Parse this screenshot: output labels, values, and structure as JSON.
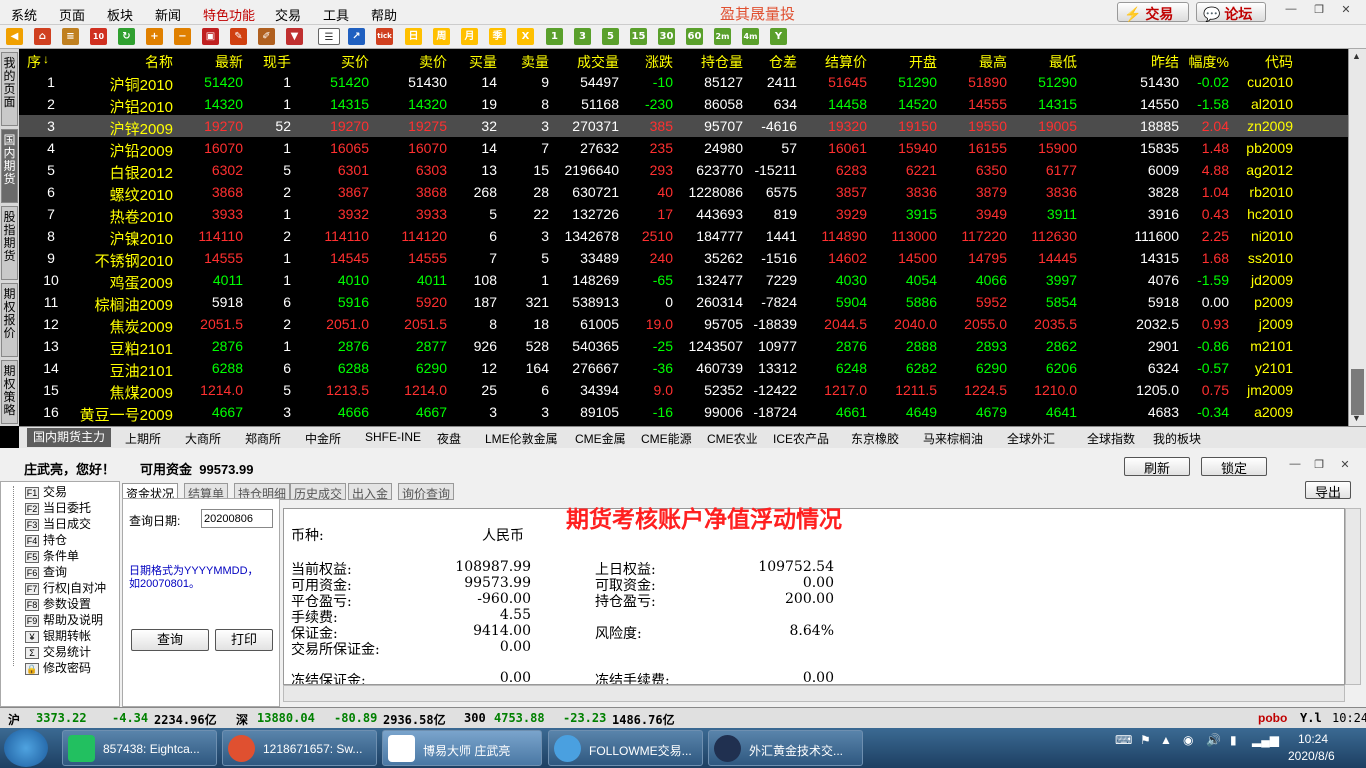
{
  "menu": {
    "items": [
      "系统",
      "页面",
      "板块",
      "新闻",
      "特色功能",
      "交易",
      "工具",
      "帮助"
    ],
    "app_title": "盈其晟量投",
    "trade_btn": "交易",
    "forum_btn": "论坛"
  },
  "toolbar": {
    "period_labels": [
      "日",
      "周",
      "月",
      "季",
      "X"
    ],
    "minute_labels": [
      "1",
      "3",
      "5",
      "15",
      "30",
      "60",
      "2m",
      "4m",
      "Y"
    ]
  },
  "sidetabs": [
    "我的页面",
    "国内期货",
    "股指期货",
    "期权报价",
    "期权策略"
  ],
  "quote_header": [
    "序",
    "名称",
    "最新",
    "现手",
    "买价",
    "卖价",
    "买量",
    "卖量",
    "成交量",
    "涨跌",
    "持仓量",
    "仓差",
    "结算价",
    "开盘",
    "最高",
    "最低",
    "昨结",
    "幅度%",
    "代码"
  ],
  "rows": [
    {
      "no": "1",
      "name": "沪铜2010",
      "last": "51420",
      "lot": "1",
      "bid": "51420",
      "ask": "51430",
      "bidv": "14",
      "askv": "9",
      "vol": "54497",
      "chg": "-10",
      "oi": "85127",
      "oichg": "2411",
      "settle": "51645",
      "open": "51290",
      "high": "51890",
      "low": "51290",
      "pre": "51430",
      "pct": "-0.02",
      "code": "cu2010",
      "dir": "down"
    },
    {
      "no": "2",
      "name": "沪铝2010",
      "last": "14320",
      "lot": "1",
      "bid": "14315",
      "ask": "14320",
      "bidv": "19",
      "askv": "8",
      "vol": "51168",
      "chg": "-230",
      "oi": "86058",
      "oichg": "634",
      "settle": "14458",
      "open": "14520",
      "high": "14555",
      "low": "14315",
      "pre": "14550",
      "pct": "-1.58",
      "code": "al2010",
      "dir": "down"
    },
    {
      "no": "3",
      "name": "沪锌2009",
      "last": "19270",
      "lot": "52",
      "bid": "19270",
      "ask": "19275",
      "bidv": "32",
      "askv": "3",
      "vol": "270371",
      "chg": "385",
      "oi": "95707",
      "oichg": "-4616",
      "settle": "19320",
      "open": "19150",
      "high": "19550",
      "low": "19005",
      "pre": "18885",
      "pct": "2.04",
      "code": "zn2009",
      "dir": "up"
    },
    {
      "no": "4",
      "name": "沪铅2009",
      "last": "16070",
      "lot": "1",
      "bid": "16065",
      "ask": "16070",
      "bidv": "14",
      "askv": "7",
      "vol": "27632",
      "chg": "235",
      "oi": "24980",
      "oichg": "57",
      "settle": "16061",
      "open": "15940",
      "high": "16155",
      "low": "15900",
      "pre": "15835",
      "pct": "1.48",
      "code": "pb2009",
      "dir": "up"
    },
    {
      "no": "5",
      "name": "白银2012",
      "last": "6302",
      "lot": "5",
      "bid": "6301",
      "ask": "6303",
      "bidv": "13",
      "askv": "15",
      "vol": "2196640",
      "chg": "293",
      "oi": "623770",
      "oichg": "-15211",
      "settle": "6283",
      "open": "6221",
      "high": "6350",
      "low": "6177",
      "pre": "6009",
      "pct": "4.88",
      "code": "ag2012",
      "dir": "up"
    },
    {
      "no": "6",
      "name": "螺纹2010",
      "last": "3868",
      "lot": "2",
      "bid": "3867",
      "ask": "3868",
      "bidv": "268",
      "askv": "28",
      "vol": "630721",
      "chg": "40",
      "oi": "1228086",
      "oichg": "6575",
      "settle": "3857",
      "open": "3836",
      "high": "3879",
      "low": "3836",
      "pre": "3828",
      "pct": "1.04",
      "code": "rb2010",
      "dir": "up"
    },
    {
      "no": "7",
      "name": "热卷2010",
      "last": "3933",
      "lot": "1",
      "bid": "3932",
      "ask": "3933",
      "bidv": "5",
      "askv": "22",
      "vol": "132726",
      "chg": "17",
      "oi": "443693",
      "oichg": "819",
      "settle": "3929",
      "open": "3915",
      "high": "3949",
      "low": "3911",
      "pre": "3916",
      "pct": "0.43",
      "code": "hc2010",
      "dir": "up"
    },
    {
      "no": "8",
      "name": "沪镍2010",
      "last": "114110",
      "lot": "2",
      "bid": "114110",
      "ask": "114120",
      "bidv": "6",
      "askv": "3",
      "vol": "1342678",
      "chg": "2510",
      "oi": "184777",
      "oichg": "1441",
      "settle": "114890",
      "open": "113000",
      "high": "117220",
      "low": "112630",
      "pre": "111600",
      "pct": "2.25",
      "code": "ni2010",
      "dir": "up"
    },
    {
      "no": "9",
      "name": "不锈钢2010",
      "last": "14555",
      "lot": "1",
      "bid": "14545",
      "ask": "14555",
      "bidv": "7",
      "askv": "5",
      "vol": "33489",
      "chg": "240",
      "oi": "35262",
      "oichg": "-1516",
      "settle": "14602",
      "open": "14500",
      "high": "14795",
      "low": "14445",
      "pre": "14315",
      "pct": "1.68",
      "code": "ss2010",
      "dir": "up"
    },
    {
      "no": "10",
      "name": "鸡蛋2009",
      "last": "4011",
      "lot": "1",
      "bid": "4010",
      "ask": "4011",
      "bidv": "108",
      "askv": "1",
      "vol": "148269",
      "chg": "-65",
      "oi": "132477",
      "oichg": "7229",
      "settle": "4030",
      "open": "4054",
      "high": "4066",
      "low": "3997",
      "pre": "4076",
      "pct": "-1.59",
      "code": "jd2009",
      "dir": "down"
    },
    {
      "no": "11",
      "name": "棕榈油2009",
      "last": "5918",
      "lot": "6",
      "bid": "5916",
      "ask": "5920",
      "bidv": "187",
      "askv": "321",
      "vol": "538913",
      "chg": "0",
      "oi": "260314",
      "oichg": "-7824",
      "settle": "5904",
      "open": "5886",
      "high": "5952",
      "low": "5854",
      "pre": "5918",
      "pct": "0.00",
      "code": "p2009",
      "dir": "flat"
    },
    {
      "no": "12",
      "name": "焦炭2009",
      "last": "2051.5",
      "lot": "2",
      "bid": "2051.0",
      "ask": "2051.5",
      "bidv": "8",
      "askv": "18",
      "vol": "61005",
      "chg": "19.0",
      "oi": "95705",
      "oichg": "-18839",
      "settle": "2044.5",
      "open": "2040.0",
      "high": "2055.0",
      "low": "2035.5",
      "pre": "2032.5",
      "pct": "0.93",
      "code": "j2009",
      "dir": "up"
    },
    {
      "no": "13",
      "name": "豆粕2101",
      "last": "2876",
      "lot": "1",
      "bid": "2876",
      "ask": "2877",
      "bidv": "926",
      "askv": "528",
      "vol": "540365",
      "chg": "-25",
      "oi": "1243507",
      "oichg": "10977",
      "settle": "2876",
      "open": "2888",
      "high": "2893",
      "low": "2862",
      "pre": "2901",
      "pct": "-0.86",
      "code": "m2101",
      "dir": "down"
    },
    {
      "no": "14",
      "name": "豆油2101",
      "last": "6288",
      "lot": "6",
      "bid": "6288",
      "ask": "6290",
      "bidv": "12",
      "askv": "164",
      "vol": "276667",
      "chg": "-36",
      "oi": "460739",
      "oichg": "13312",
      "settle": "6248",
      "open": "6282",
      "high": "6290",
      "low": "6206",
      "pre": "6324",
      "pct": "-0.57",
      "code": "y2101",
      "dir": "down"
    },
    {
      "no": "15",
      "name": "焦煤2009",
      "last": "1214.0",
      "lot": "5",
      "bid": "1213.5",
      "ask": "1214.0",
      "bidv": "25",
      "askv": "6",
      "vol": "34394",
      "chg": "9.0",
      "oi": "52352",
      "oichg": "-12422",
      "settle": "1217.0",
      "open": "1211.5",
      "high": "1224.5",
      "low": "1210.0",
      "pre": "1205.0",
      "pct": "0.75",
      "code": "jm2009",
      "dir": "up"
    },
    {
      "no": "16",
      "name": "黄豆一号2009",
      "last": "4667",
      "lot": "3",
      "bid": "4666",
      "ask": "4667",
      "bidv": "3",
      "askv": "3",
      "vol": "89105",
      "chg": "-16",
      "oi": "99006",
      "oichg": "-18724",
      "settle": "4661",
      "open": "4649",
      "high": "4679",
      "low": "4641",
      "pre": "4683",
      "pct": "-0.34",
      "code": "a2009",
      "dir": "down"
    }
  ],
  "bottom_tabs": [
    "国内期货主力",
    "上期所",
    "大商所",
    "郑商所",
    "中金所",
    "SHFE-INE",
    "夜盘",
    "LME伦敦金属",
    "CME金属",
    "CME能源",
    "CME农业",
    "ICE农产品",
    "东京橡胶",
    "马来棕榈油",
    "全球外汇",
    "全球指数",
    "我的板块"
  ],
  "trade": {
    "greeting": "庄武亮，您好！",
    "avail_label": "可用资金",
    "avail_value": "99573.99",
    "refresh": "刷新",
    "lock": "锁定",
    "export": "导出",
    "functions": [
      {
        "key": "F1",
        "label": "交易"
      },
      {
        "key": "F2",
        "label": "当日委托"
      },
      {
        "key": "F3",
        "label": "当日成交"
      },
      {
        "key": "F4",
        "label": "持仓"
      },
      {
        "key": "F5",
        "label": "条件单"
      },
      {
        "key": "F6",
        "label": "查询"
      },
      {
        "key": "F7",
        "label": "行权|自对冲"
      },
      {
        "key": "F8",
        "label": "参数设置"
      },
      {
        "key": "F9",
        "label": "帮助及说明"
      },
      {
        "key": "¥",
        "label": "银期转帐"
      },
      {
        "key": "Σ",
        "label": "交易统计"
      },
      {
        "key": "🔒",
        "label": "修改密码"
      }
    ],
    "subtabs": [
      "资金状况",
      "结算单",
      "持仓明细",
      "历史成交",
      "出入金",
      "询价查询"
    ],
    "query_date_label": "查询日期:",
    "query_date_value": "20200806",
    "date_hint": "日期格式为YYYYMMDD，如20070801。",
    "query_btn": "查询",
    "print_btn": "打印",
    "overlay_title": "期货考核账户净值浮动情况",
    "report": {
      "currency_label": "币种:",
      "currency_value": "人民币",
      "left": [
        {
          "label": "当前权益:",
          "value": "108987.99"
        },
        {
          "label": "可用资金:",
          "value": "99573.99"
        },
        {
          "label": "平仓盈亏:",
          "value": "-960.00"
        },
        {
          "label": "手续费:",
          "value": "4.55"
        },
        {
          "label": "保证金:",
          "value": "9414.00"
        },
        {
          "label": "交易所保证金:",
          "value": "0.00"
        }
      ],
      "right": [
        {
          "label": "上日权益:",
          "value": "109752.54"
        },
        {
          "label": "可取资金:",
          "value": "0.00"
        },
        {
          "label": "持仓盈亏:",
          "value": "200.00"
        },
        {
          "label": "风险度:",
          "value": "8.64%"
        }
      ],
      "frozen_margin_label": "冻结保证金:",
      "frozen_margin_value": "0.00",
      "frozen_fee_label": "冻结手续费:",
      "frozen_fee_value": "0.00"
    }
  },
  "status": {
    "sh_label": "沪",
    "sh_idx": "3373.22",
    "sh_chg": "-4.34",
    "sh_amt": "2234.96亿",
    "sz_label": "深",
    "sz_idx": "13880.04",
    "sz_chg": "-80.89",
    "sz_amt": "2936.58亿",
    "c300_label": "300",
    "c300_idx": "4753.88",
    "c300_chg": "-23.23",
    "c300_amt": "1486.76亿",
    "brand": "pobo",
    "time": "10:24"
  },
  "taskbar": {
    "items": [
      "857438: Eightca...",
      "1218671657: Sw...",
      "博易大师 庄武亮",
      "FOLLOWME交易...",
      "外汇黄金技术交..."
    ],
    "time": "10:24",
    "date": "2020/8/6"
  },
  "colors": {
    "up": "#ff3030",
    "down": "#00ff00",
    "flat": "#ffffff",
    "name": "#ffff00",
    "header": "#ffff00",
    "code": "#ffff00"
  }
}
